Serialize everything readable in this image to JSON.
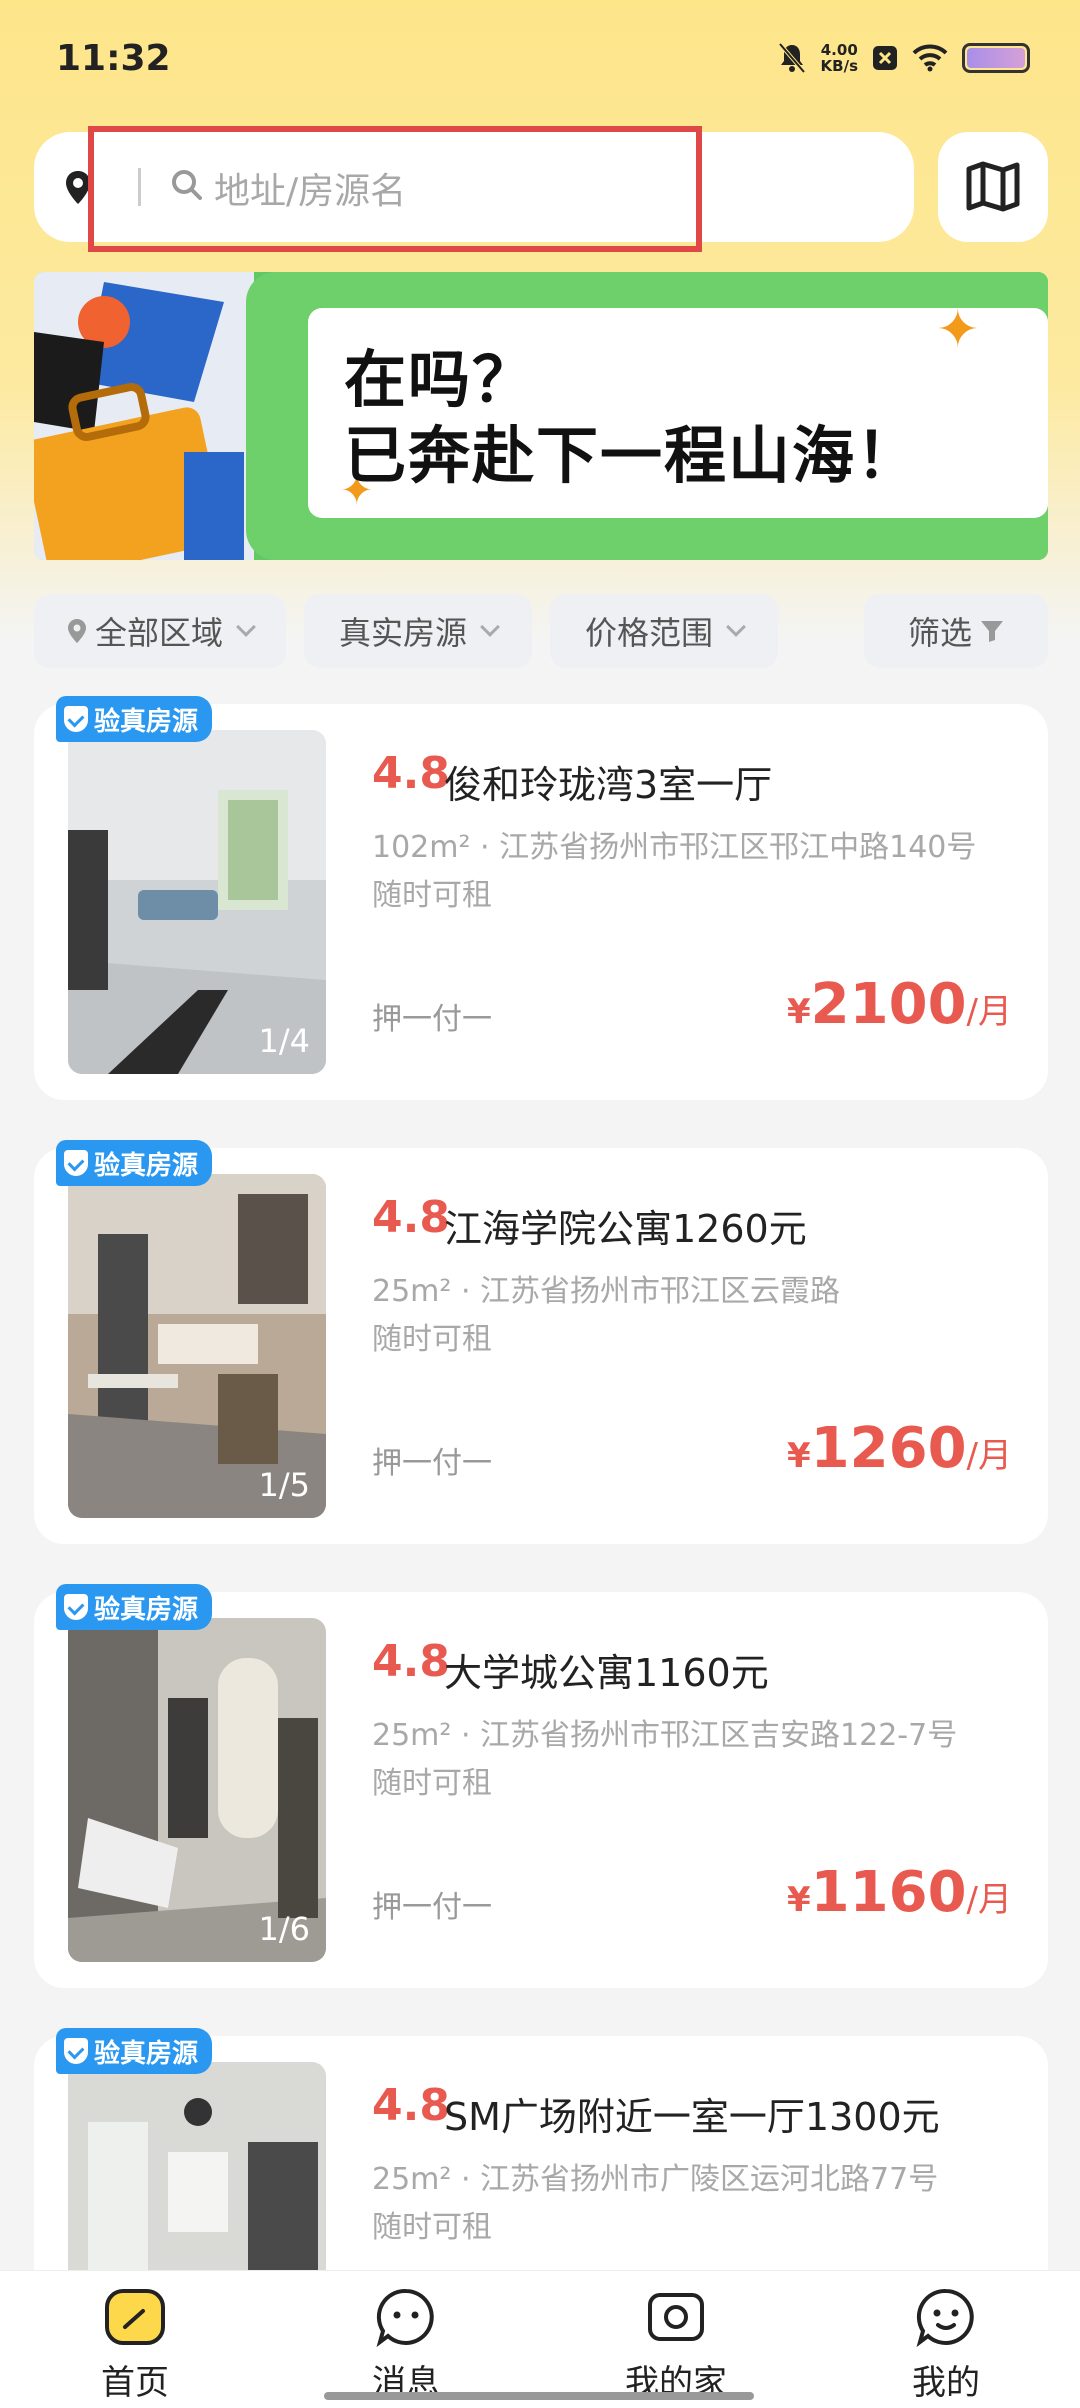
{
  "status_bar": {
    "time": "11:32",
    "net_speed_value": "4.00",
    "net_speed_unit": "KB/s",
    "icons": [
      "mute-bell-icon",
      "x-box-icon",
      "wifi-icon",
      "battery-icon"
    ]
  },
  "search": {
    "placeholder": "地址/房源名",
    "location_icon": "location-pin-icon",
    "map_icon": "map-icon"
  },
  "banner": {
    "line1": "在吗？",
    "line2": "已奔赴下一程山海！"
  },
  "filters": [
    {
      "label": "全部区域",
      "icon": "location-pin-icon"
    },
    {
      "label": "真实房源"
    },
    {
      "label": "价格范围"
    },
    {
      "label": "筛选",
      "icon": "filter-icon"
    }
  ],
  "listings": [
    {
      "badge": "验真房源",
      "rating": "4.8",
      "title": "俊和玲珑湾3室一厅",
      "area": "102m²",
      "address": "江苏省扬州市邗江区邗江中路140号",
      "availability": "随时可租",
      "deposit": "押一付一",
      "currency": "¥",
      "price": "2100",
      "unit": "/月",
      "photo_counter": "1/4"
    },
    {
      "badge": "验真房源",
      "rating": "4.8",
      "title": "江海学院公寓1260元",
      "area": "25m²",
      "address": "江苏省扬州市邗江区云霞路",
      "availability": "随时可租",
      "deposit": "押一付一",
      "currency": "¥",
      "price": "1260",
      "unit": "/月",
      "photo_counter": "1/5"
    },
    {
      "badge": "验真房源",
      "rating": "4.8",
      "title": "大学城公寓1160元",
      "area": "25m²",
      "address": "江苏省扬州市邗江区吉安路122-7号",
      "availability": "随时可租",
      "deposit": "押一付一",
      "currency": "¥",
      "price": "1160",
      "unit": "/月",
      "photo_counter": "1/6"
    },
    {
      "badge": "验真房源",
      "rating": "4.8",
      "title": "SM广场附近一室一厅1300元",
      "area": "25m²",
      "address": "江苏省扬州市广陵区运河北路77号",
      "availability": "随时可租"
    }
  ],
  "bottom_nav": [
    {
      "label": "首页",
      "icon": "home-icon",
      "active": true
    },
    {
      "label": "消息",
      "icon": "message-icon"
    },
    {
      "label": "我的家",
      "icon": "camera-home-icon"
    },
    {
      "label": "我的",
      "icon": "profile-icon"
    }
  ],
  "colors": {
    "accent_red": "#e85a4f",
    "badge_blue": "#2a98f0",
    "brand_yellow": "#fdd84a"
  }
}
